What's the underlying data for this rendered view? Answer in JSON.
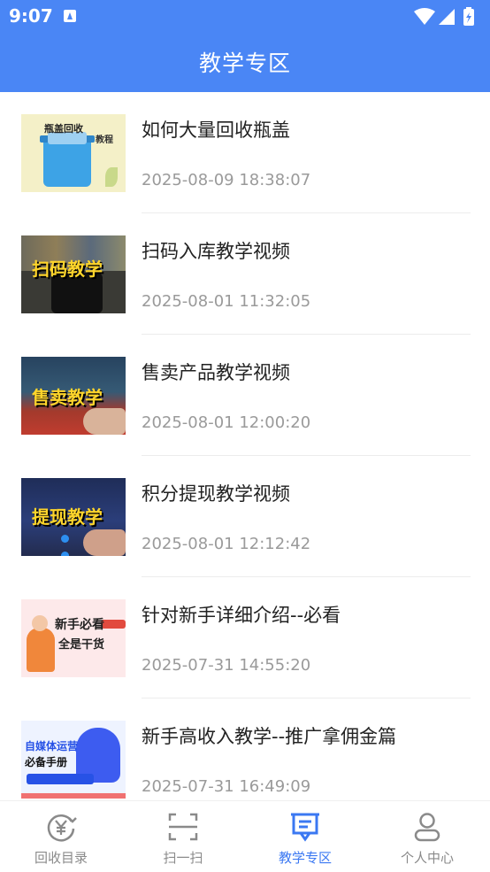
{
  "status_bar": {
    "time": "9:07"
  },
  "header": {
    "title": "教学专区"
  },
  "items": [
    {
      "title": "如何大量回收瓶盖",
      "date": "2025-08-09 18:38:07",
      "thumb_text": "瓶盖回收",
      "thumb_text2": "教程"
    },
    {
      "title": "扫码入库教学视频",
      "date": "2025-08-01 11:32:05",
      "thumb_text": "扫码教学"
    },
    {
      "title": "售卖产品教学视频",
      "date": "2025-08-01 12:00:20",
      "thumb_text": "售卖教学"
    },
    {
      "title": "积分提现教学视频",
      "date": "2025-08-01 12:12:42",
      "thumb_text": "提现教学"
    },
    {
      "title": "针对新手详细介绍--必看",
      "date": "2025-07-31 14:55:20",
      "thumb_text": "新手必看",
      "thumb_text2": "全是干货"
    },
    {
      "title": "新手高收入教学--推广拿佣金篇",
      "date": "2025-07-31 16:49:09",
      "thumb_text": "自媒体运营",
      "thumb_text2": "必备手册"
    }
  ],
  "tabs": [
    {
      "label": "回收目录",
      "icon": "yen-cycle-icon",
      "active": false
    },
    {
      "label": "扫一扫",
      "icon": "scan-icon",
      "active": false
    },
    {
      "label": "教学专区",
      "icon": "teaching-board-icon",
      "active": true
    },
    {
      "label": "个人中心",
      "icon": "user-icon",
      "active": false
    }
  ],
  "colors": {
    "accent": "#4a86f5",
    "active_tab": "#3b78f2",
    "inactive_tab": "#8a8a8a",
    "date_text": "#9a9a9a"
  }
}
